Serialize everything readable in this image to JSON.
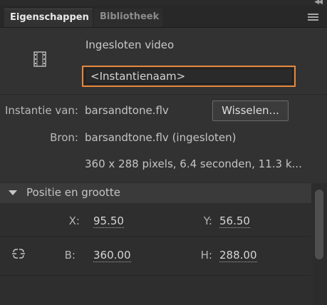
{
  "panel": {
    "tabs": [
      {
        "label": "Eigenschappen",
        "active": true
      },
      {
        "label": "Bibliotheek",
        "active": false
      }
    ],
    "menu_icon": "hamburger-menu-icon",
    "collapse_icon": "double-chevron-icon"
  },
  "instance": {
    "icon": "film-strip-icon",
    "type_label": "Ingesloten video",
    "name_placeholder": "<Instantienaam>",
    "highlight_color": "#e8883a"
  },
  "properties": {
    "instance_of_label": "Instantie van:",
    "instance_of_value": "barsandtone.flv",
    "swap_button": "Wisselen...",
    "source_label": "Bron:",
    "source_value": "barsandtone.flv (ingesloten)",
    "info_value": "360 x 288 pixels, 6.4 seconden, 11.3 k..."
  },
  "position_size": {
    "title": "Positie en grootte",
    "x_label": "X:",
    "x_value": "95.50",
    "y_label": "Y:",
    "y_value": "56.50",
    "link_icon": "link-proportions-icon",
    "w_label": "B:",
    "w_value": "360.00",
    "h_label": "H:",
    "h_value": "288.00"
  }
}
